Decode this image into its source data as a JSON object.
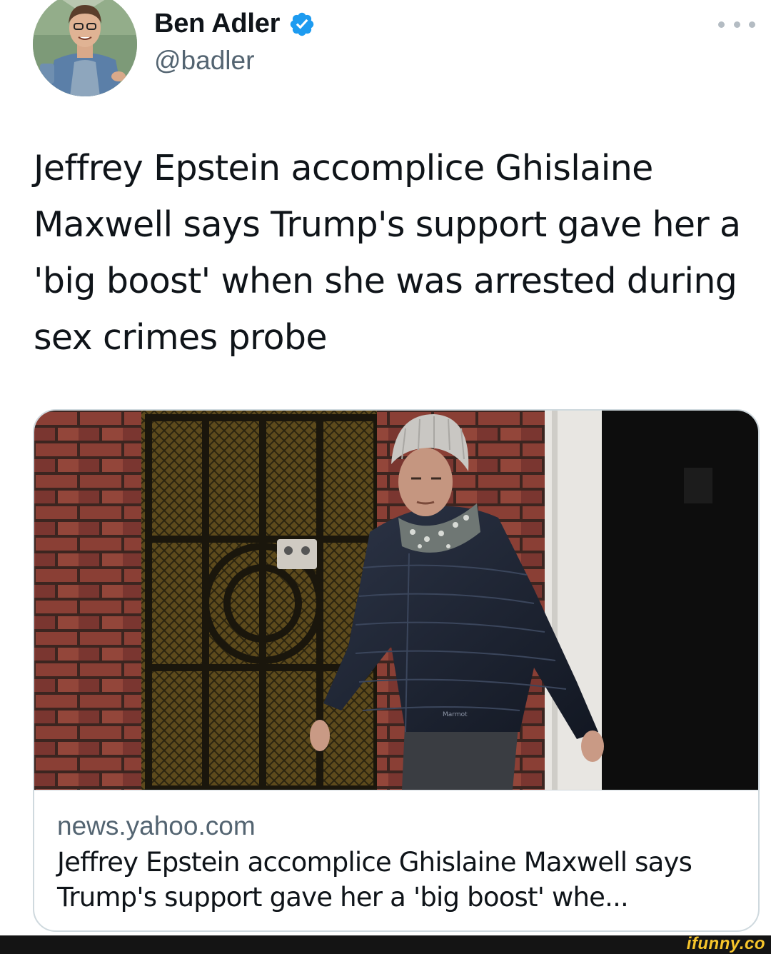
{
  "author": {
    "display_name": "Ben Adler",
    "handle": "@badler",
    "verified_icon": "verified-badge-icon",
    "avatar_icon": "user-avatar"
  },
  "tweet": {
    "text": "Jeffrey Epstein accomplice Ghislaine Maxwell says Trump's support gave her a 'big boost' when she was arrested during sex crimes probe"
  },
  "card": {
    "domain": "news.yahoo.com",
    "title": "Jeffrey Epstein accomplice Ghislaine Maxwell says Trump's support gave her a 'big boost' whe...",
    "jacket_brand": "Marmot"
  },
  "watermark": "ifunny.co",
  "colors": {
    "verified": "#1d9bf0",
    "secondary_text": "#536471",
    "border": "#cfd9de",
    "watermark": "#f7c52b"
  }
}
